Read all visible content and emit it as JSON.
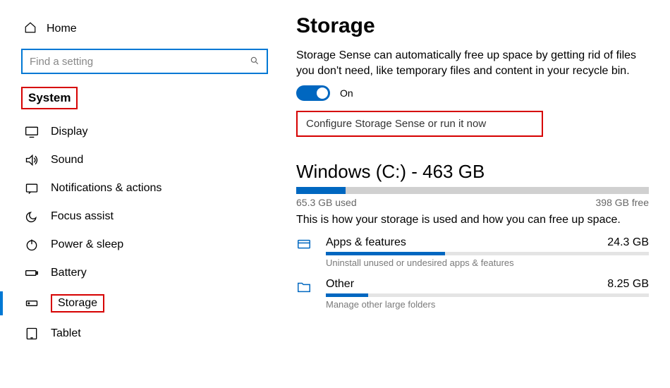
{
  "sidebar": {
    "home": "Home",
    "search_placeholder": "Find a setting",
    "section": "System",
    "items": [
      {
        "label": "Display"
      },
      {
        "label": "Sound"
      },
      {
        "label": "Notifications & actions"
      },
      {
        "label": "Focus assist"
      },
      {
        "label": "Power & sleep"
      },
      {
        "label": "Battery"
      },
      {
        "label": "Storage"
      },
      {
        "label": "Tablet"
      }
    ]
  },
  "main": {
    "title": "Storage",
    "storage_sense_desc": "Storage Sense can automatically free up space by getting rid of files you don't need, like temporary files and content in your recycle bin.",
    "toggle_label": "On",
    "config_link": "Configure Storage Sense or run it now",
    "drive_title": "Windows (C:) - 463 GB",
    "used_label": "65.3 GB used",
    "free_label": "398 GB free",
    "usage_desc": "This is how your storage is used and how you can free up space.",
    "categories": [
      {
        "name": "Apps & features",
        "size": "24.3 GB",
        "sub": "Uninstall unused or undesired apps & features",
        "pct": 37
      },
      {
        "name": "Other",
        "size": "8.25 GB",
        "sub": "Manage other large folders",
        "pct": 13
      }
    ]
  }
}
